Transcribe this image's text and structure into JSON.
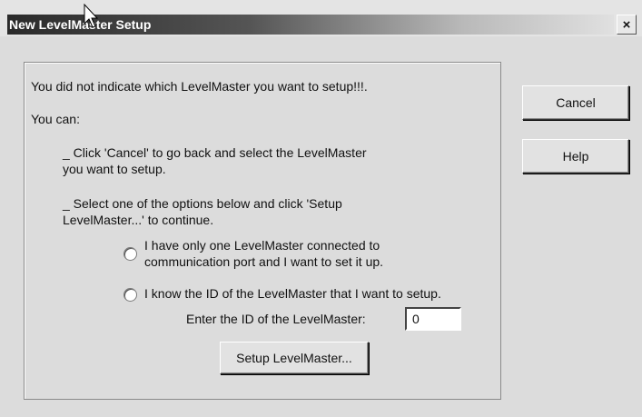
{
  "window": {
    "title": "New LevelMaster Setup",
    "close_icon": "close-icon",
    "close_glyph": "×"
  },
  "message": {
    "line1": "You did not indicate which LevelMaster you want to setup!!!.",
    "line2": "You can:",
    "option_cancel_line1": "_ Click 'Cancel' to go back and select the LevelMaster",
    "option_cancel_line2": "you want to setup.",
    "option_select_line1": "_ Select one of the options below and click 'Setup",
    "option_select_line2": "LevelMaster...' to continue."
  },
  "radios": [
    {
      "line1": "I have only one LevelMaster connected to",
      "line2": "communication port and I want to set it up.",
      "selected": false
    },
    {
      "line1": "I know the ID of the LevelMaster that I want to setup.",
      "selected": false
    }
  ],
  "id_field": {
    "label": "Enter the ID of the LevelMaster:",
    "value": "0"
  },
  "buttons": {
    "setup": "Setup LevelMaster...",
    "cancel": "Cancel",
    "help": "Help"
  }
}
